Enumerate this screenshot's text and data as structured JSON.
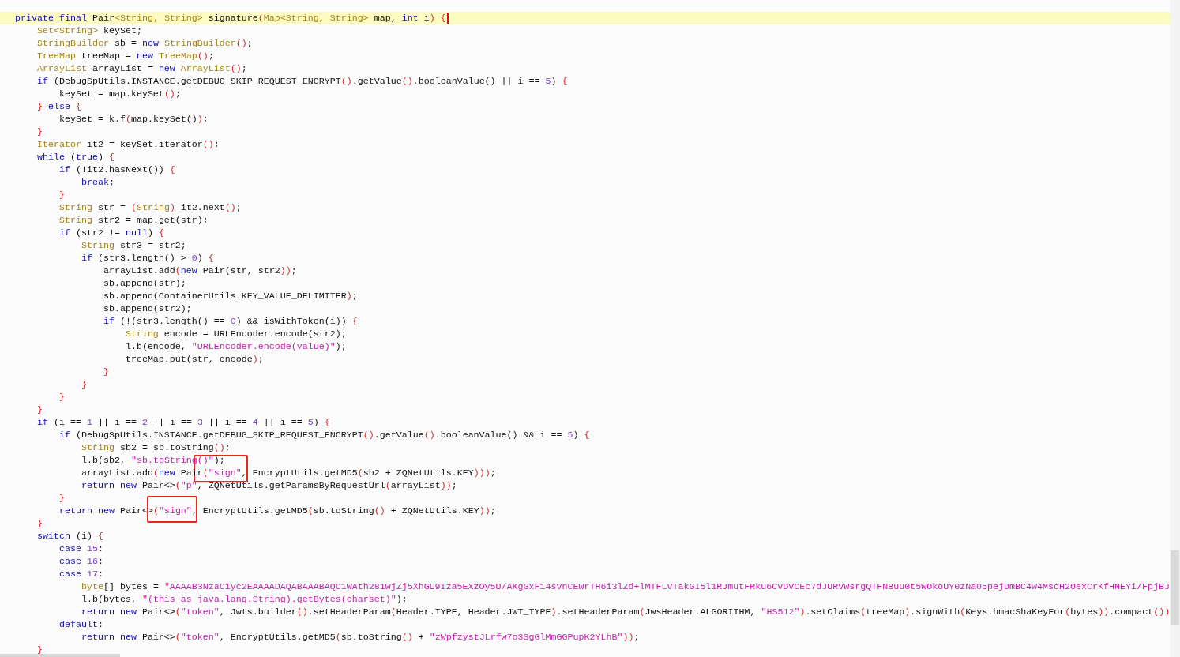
{
  "editor": {
    "lines": [
      {
        "current": true,
        "tokens": [
          {
            "kind": "keyword",
            "text": "private final"
          },
          {
            "kind": "plain",
            "text": " Pair"
          },
          {
            "kind": "type",
            "text": "<String, String>"
          },
          {
            "kind": "plain",
            "text": " signature"
          },
          {
            "kind": "bracket",
            "text": "("
          },
          {
            "kind": "type",
            "text": "Map<String, String>"
          },
          {
            "kind": "plain",
            "text": " map, "
          },
          {
            "kind": "keyword",
            "text": "int"
          },
          {
            "kind": "plain",
            "text": " i"
          },
          {
            "kind": "bracket",
            "text": ")"
          },
          {
            "kind": "bracket",
            "text": " {"
          }
        ]
      },
      {
        "current": false,
        "tokens": [
          {
            "kind": "type",
            "text": "    Set<String>"
          },
          {
            "kind": "plain",
            "text": " keySet;"
          }
        ]
      },
      {
        "current": false,
        "tokens": [
          {
            "kind": "type",
            "text": "    StringBuilder"
          },
          {
            "kind": "plain",
            "text": " sb = "
          },
          {
            "kind": "keyword",
            "text": "new"
          },
          {
            "kind": "type",
            "text": " StringBuilder"
          },
          {
            "kind": "bracket",
            "text": "()"
          },
          {
            "kind": "plain",
            "text": ";"
          }
        ]
      },
      {
        "current": false,
        "tokens": [
          {
            "kind": "type",
            "text": "    TreeMap"
          },
          {
            "kind": "plain",
            "text": " treeMap = "
          },
          {
            "kind": "keyword",
            "text": "new"
          },
          {
            "kind": "type",
            "text": " TreeMap"
          },
          {
            "kind": "bracket",
            "text": "()"
          },
          {
            "kind": "plain",
            "text": ";"
          }
        ]
      },
      {
        "current": false,
        "tokens": [
          {
            "kind": "type",
            "text": "    ArrayList"
          },
          {
            "kind": "plain",
            "text": " arrayList = "
          },
          {
            "kind": "keyword",
            "text": "new"
          },
          {
            "kind": "type",
            "text": " ArrayList"
          },
          {
            "kind": "bracket",
            "text": "()"
          },
          {
            "kind": "plain",
            "text": ";"
          }
        ]
      },
      {
        "current": false,
        "tokens": [
          {
            "kind": "keyword",
            "text": "    if"
          },
          {
            "kind": "plain",
            "text": " (DebugSpUtils.INSTANCE.getDEBUG_SKIP_REQUEST_ENCRYPT"
          },
          {
            "kind": "bracket",
            "text": "()"
          },
          {
            "kind": "plain",
            "text": ".getValue"
          },
          {
            "kind": "bracket",
            "text": "()"
          },
          {
            "kind": "plain",
            "text": ".booleanValue() || i == "
          },
          {
            "kind": "number",
            "text": "5"
          },
          {
            "kind": "plain",
            "text": ")"
          },
          {
            "kind": "bracket",
            "text": " {"
          }
        ]
      },
      {
        "current": false,
        "tokens": [
          {
            "kind": "plain",
            "text": "        keySet = map.keySet"
          },
          {
            "kind": "bracket",
            "text": "()"
          },
          {
            "kind": "plain",
            "text": ";"
          }
        ]
      },
      {
        "current": false,
        "tokens": [
          {
            "kind": "bracket",
            "text": "    }"
          },
          {
            "kind": "keyword",
            "text": " else"
          },
          {
            "kind": "bracket",
            "text": " {"
          }
        ]
      },
      {
        "current": false,
        "tokens": [
          {
            "kind": "plain",
            "text": "        keySet = k.f"
          },
          {
            "kind": "bracket",
            "text": "("
          },
          {
            "kind": "plain",
            "text": "map.keySet()"
          },
          {
            "kind": "bracket",
            "text": ")"
          },
          {
            "kind": "plain",
            "text": ";"
          }
        ]
      },
      {
        "current": false,
        "tokens": [
          {
            "kind": "bracket",
            "text": "    }"
          }
        ]
      },
      {
        "current": false,
        "tokens": [
          {
            "kind": "type",
            "text": "    Iterator"
          },
          {
            "kind": "plain",
            "text": " it2 = keySet.iterator"
          },
          {
            "kind": "bracket",
            "text": "()"
          },
          {
            "kind": "plain",
            "text": ";"
          }
        ]
      },
      {
        "current": false,
        "tokens": [
          {
            "kind": "keyword",
            "text": "    while"
          },
          {
            "kind": "plain",
            "text": " ("
          },
          {
            "kind": "keyword",
            "text": "true"
          },
          {
            "kind": "plain",
            "text": ")"
          },
          {
            "kind": "bracket",
            "text": " {"
          }
        ]
      },
      {
        "current": false,
        "tokens": [
          {
            "kind": "keyword",
            "text": "        if"
          },
          {
            "kind": "plain",
            "text": " (!it2.hasNext())"
          },
          {
            "kind": "bracket",
            "text": " {"
          }
        ]
      },
      {
        "current": false,
        "tokens": [
          {
            "kind": "keyword",
            "text": "            break"
          },
          {
            "kind": "plain",
            "text": ";"
          }
        ]
      },
      {
        "current": false,
        "tokens": [
          {
            "kind": "bracket",
            "text": "        }"
          }
        ]
      },
      {
        "current": false,
        "tokens": [
          {
            "kind": "type",
            "text": "        String"
          },
          {
            "kind": "plain",
            "text": " str = "
          },
          {
            "kind": "bracket",
            "text": "("
          },
          {
            "kind": "type",
            "text": "String"
          },
          {
            "kind": "bracket",
            "text": ")"
          },
          {
            "kind": "plain",
            "text": " it2.next"
          },
          {
            "kind": "bracket",
            "text": "()"
          },
          {
            "kind": "plain",
            "text": ";"
          }
        ]
      },
      {
        "current": false,
        "tokens": [
          {
            "kind": "type",
            "text": "        String"
          },
          {
            "kind": "plain",
            "text": " str2 = map.get(str);"
          }
        ]
      },
      {
        "current": false,
        "tokens": [
          {
            "kind": "keyword",
            "text": "        if"
          },
          {
            "kind": "plain",
            "text": " (str2 != "
          },
          {
            "kind": "keyword",
            "text": "null"
          },
          {
            "kind": "plain",
            "text": ")"
          },
          {
            "kind": "bracket",
            "text": " {"
          }
        ]
      },
      {
        "current": false,
        "tokens": [
          {
            "kind": "type",
            "text": "            String"
          },
          {
            "kind": "plain",
            "text": " str3 = str2;"
          }
        ]
      },
      {
        "current": false,
        "tokens": [
          {
            "kind": "keyword",
            "text": "            if"
          },
          {
            "kind": "plain",
            "text": " (str3.length() > "
          },
          {
            "kind": "number",
            "text": "0"
          },
          {
            "kind": "plain",
            "text": ")"
          },
          {
            "kind": "bracket",
            "text": " {"
          }
        ]
      },
      {
        "current": false,
        "tokens": [
          {
            "kind": "plain",
            "text": "                arrayList.add"
          },
          {
            "kind": "bracket",
            "text": "("
          },
          {
            "kind": "keyword",
            "text": "new"
          },
          {
            "kind": "plain",
            "text": " Pair(str, str2"
          },
          {
            "kind": "bracket",
            "text": "))"
          },
          {
            "kind": "plain",
            "text": ";"
          }
        ]
      },
      {
        "current": false,
        "tokens": [
          {
            "kind": "plain",
            "text": "                sb.append(str);"
          }
        ]
      },
      {
        "current": false,
        "tokens": [
          {
            "kind": "plain",
            "text": "                sb.append(ContainerUtils.KEY_VALUE_DELIMITER"
          },
          {
            "kind": "bracket",
            "text": ")"
          },
          {
            "kind": "plain",
            "text": ";"
          }
        ]
      },
      {
        "current": false,
        "tokens": [
          {
            "kind": "plain",
            "text": "                sb.append(str2);"
          }
        ]
      },
      {
        "current": false,
        "tokens": [
          {
            "kind": "keyword",
            "text": "                if"
          },
          {
            "kind": "plain",
            "text": " (!(str3.length() == "
          },
          {
            "kind": "number",
            "text": "0"
          },
          {
            "kind": "plain",
            "text": ") && isWithToken(i))"
          },
          {
            "kind": "bracket",
            "text": " {"
          }
        ]
      },
      {
        "current": false,
        "tokens": [
          {
            "kind": "type",
            "text": "                    String"
          },
          {
            "kind": "plain",
            "text": " encode = URLEncoder.encode(str2);"
          }
        ]
      },
      {
        "current": false,
        "tokens": [
          {
            "kind": "plain",
            "text": "                    l.b(encode, "
          },
          {
            "kind": "string",
            "text": "\"URLEncoder.encode(value)\""
          },
          {
            "kind": "plain",
            "text": ");"
          }
        ]
      },
      {
        "current": false,
        "tokens": [
          {
            "kind": "plain",
            "text": "                    treeMap.put(str, encode"
          },
          {
            "kind": "bracket",
            "text": ")"
          },
          {
            "kind": "plain",
            "text": ";"
          }
        ]
      },
      {
        "current": false,
        "tokens": [
          {
            "kind": "bracket",
            "text": "                }"
          }
        ]
      },
      {
        "current": false,
        "tokens": [
          {
            "kind": "bracket",
            "text": "            }"
          }
        ]
      },
      {
        "current": false,
        "tokens": [
          {
            "kind": "bracket",
            "text": "        }"
          }
        ]
      },
      {
        "current": false,
        "tokens": [
          {
            "kind": "bracket",
            "text": "    }"
          }
        ]
      },
      {
        "current": false,
        "tokens": [
          {
            "kind": "keyword",
            "text": "    if"
          },
          {
            "kind": "plain",
            "text": " (i == "
          },
          {
            "kind": "number",
            "text": "1"
          },
          {
            "kind": "plain",
            "text": " || i == "
          },
          {
            "kind": "number",
            "text": "2"
          },
          {
            "kind": "plain",
            "text": " || i == "
          },
          {
            "kind": "number",
            "text": "3"
          },
          {
            "kind": "plain",
            "text": " || i == "
          },
          {
            "kind": "number",
            "text": "4"
          },
          {
            "kind": "plain",
            "text": " || i == "
          },
          {
            "kind": "number",
            "text": "5"
          },
          {
            "kind": "plain",
            "text": ")"
          },
          {
            "kind": "bracket",
            "text": " {"
          }
        ]
      },
      {
        "current": false,
        "tokens": [
          {
            "kind": "keyword",
            "text": "        if"
          },
          {
            "kind": "plain",
            "text": " (DebugSpUtils.INSTANCE.getDEBUG_SKIP_REQUEST_ENCRYPT"
          },
          {
            "kind": "bracket",
            "text": "()"
          },
          {
            "kind": "plain",
            "text": ".getValue"
          },
          {
            "kind": "bracket",
            "text": "()"
          },
          {
            "kind": "plain",
            "text": ".booleanValue() && i == "
          },
          {
            "kind": "number",
            "text": "5"
          },
          {
            "kind": "plain",
            "text": ")"
          },
          {
            "kind": "bracket",
            "text": " {"
          }
        ]
      },
      {
        "current": false,
        "tokens": [
          {
            "kind": "type",
            "text": "            String"
          },
          {
            "kind": "plain",
            "text": " sb2 = sb.toString"
          },
          {
            "kind": "bracket",
            "text": "()"
          },
          {
            "kind": "plain",
            "text": ";"
          }
        ]
      },
      {
        "current": false,
        "tokens": [
          {
            "kind": "plain",
            "text": "            l.b(sb2, "
          },
          {
            "kind": "string",
            "text": "\"sb.toString()\""
          },
          {
            "kind": "plain",
            "text": ");"
          }
        ]
      },
      {
        "current": false,
        "tokens": [
          {
            "kind": "plain",
            "text": "            arrayList.add"
          },
          {
            "kind": "bracket",
            "text": "("
          },
          {
            "kind": "keyword",
            "text": "new"
          },
          {
            "kind": "plain",
            "text": " Pair"
          },
          {
            "kind": "bracket",
            "text": "("
          },
          {
            "kind": "string",
            "text": "\"sign\""
          },
          {
            "kind": "plain",
            "text": ", EncryptUtils.getMD5"
          },
          {
            "kind": "bracket",
            "text": "("
          },
          {
            "kind": "plain",
            "text": "sb2 + ZQNetUtils.KEY"
          },
          {
            "kind": "bracket",
            "text": ")))"
          },
          {
            "kind": "plain",
            "text": ";"
          }
        ]
      },
      {
        "current": false,
        "tokens": [
          {
            "kind": "keyword",
            "text": "            return new"
          },
          {
            "kind": "plain",
            "text": " Pair<>"
          },
          {
            "kind": "bracket",
            "text": "("
          },
          {
            "kind": "string",
            "text": "\"p\""
          },
          {
            "kind": "plain",
            "text": ", ZQNetUtils.getParamsByRequestUrl"
          },
          {
            "kind": "bracket",
            "text": "("
          },
          {
            "kind": "plain",
            "text": "arrayList"
          },
          {
            "kind": "bracket",
            "text": "))"
          },
          {
            "kind": "plain",
            "text": ";"
          }
        ]
      },
      {
        "current": false,
        "tokens": [
          {
            "kind": "bracket",
            "text": "        }"
          }
        ]
      },
      {
        "current": false,
        "tokens": [
          {
            "kind": "keyword",
            "text": "        return new"
          },
          {
            "kind": "plain",
            "text": " Pair<>"
          },
          {
            "kind": "bracket",
            "text": "("
          },
          {
            "kind": "string",
            "text": "\"sign\""
          },
          {
            "kind": "plain",
            "text": ", EncryptUtils.getMD5"
          },
          {
            "kind": "bracket",
            "text": "("
          },
          {
            "kind": "plain",
            "text": "sb.toString"
          },
          {
            "kind": "bracket",
            "text": "()"
          },
          {
            "kind": "plain",
            "text": " + ZQNetUtils.KEY"
          },
          {
            "kind": "bracket",
            "text": "))"
          },
          {
            "kind": "plain",
            "text": ";"
          }
        ]
      },
      {
        "current": false,
        "tokens": [
          {
            "kind": "bracket",
            "text": "    }"
          }
        ]
      },
      {
        "current": false,
        "tokens": [
          {
            "kind": "keyword",
            "text": "    switch"
          },
          {
            "kind": "plain",
            "text": " (i)"
          },
          {
            "kind": "bracket",
            "text": " {"
          }
        ]
      },
      {
        "current": false,
        "tokens": [
          {
            "kind": "keyword",
            "text": "        case"
          },
          {
            "kind": "number",
            "text": " 15"
          },
          {
            "kind": "plain",
            "text": ":"
          }
        ]
      },
      {
        "current": false,
        "tokens": [
          {
            "kind": "keyword",
            "text": "        case"
          },
          {
            "kind": "number",
            "text": " 16"
          },
          {
            "kind": "plain",
            "text": ":"
          }
        ]
      },
      {
        "current": false,
        "tokens": [
          {
            "kind": "keyword",
            "text": "        case"
          },
          {
            "kind": "number",
            "text": " 17"
          },
          {
            "kind": "plain",
            "text": ":"
          }
        ]
      },
      {
        "current": false,
        "tokens": [
          {
            "kind": "type",
            "text": "            byte"
          },
          {
            "kind": "plain",
            "text": "[] bytes = "
          },
          {
            "kind": "string",
            "text": "\"AAAAB3NzaC1yc2EAAAADAQABAAABAQC1WAth281wjZj5XhGU9Iza5EXzOy5U/AKgGxF14svnCEWrTH6i3lZd+lMTFLvTakGI5l1RJmutFRku6CvDVCEc7dJURVWsrgQTFNBuu0t5WOkoUY0zNa05pejDmBC4w4MscH2OexCrKfHNEYi/FpjBJ"
          }
        ]
      },
      {
        "current": false,
        "tokens": [
          {
            "kind": "plain",
            "text": "            l.b(bytes, "
          },
          {
            "kind": "string",
            "text": "\"(this as java.lang.String).getBytes(charset)\""
          },
          {
            "kind": "plain",
            "text": ");"
          }
        ]
      },
      {
        "current": false,
        "tokens": [
          {
            "kind": "keyword",
            "text": "            return new"
          },
          {
            "kind": "plain",
            "text": " Pair<>"
          },
          {
            "kind": "bracket",
            "text": "("
          },
          {
            "kind": "string",
            "text": "\"token\""
          },
          {
            "kind": "plain",
            "text": ", Jwts.builder"
          },
          {
            "kind": "bracket",
            "text": "()"
          },
          {
            "kind": "plain",
            "text": ".setHeaderParam"
          },
          {
            "kind": "bracket",
            "text": "("
          },
          {
            "kind": "plain",
            "text": "Header.TYPE, Header.JWT_TYPE"
          },
          {
            "kind": "bracket",
            "text": ")"
          },
          {
            "kind": "plain",
            "text": ".setHeaderParam"
          },
          {
            "kind": "bracket",
            "text": "("
          },
          {
            "kind": "plain",
            "text": "JwsHeader.ALGORITHM, "
          },
          {
            "kind": "string",
            "text": "\"HS512\""
          },
          {
            "kind": "bracket",
            "text": ")"
          },
          {
            "kind": "plain",
            "text": ".setClaims"
          },
          {
            "kind": "bracket",
            "text": "("
          },
          {
            "kind": "plain",
            "text": "treeMap"
          },
          {
            "kind": "bracket",
            "text": ")"
          },
          {
            "kind": "plain",
            "text": ".signWith"
          },
          {
            "kind": "bracket",
            "text": "("
          },
          {
            "kind": "plain",
            "text": "Keys.hmacShaKeyFor"
          },
          {
            "kind": "bracket",
            "text": "("
          },
          {
            "kind": "plain",
            "text": "bytes"
          },
          {
            "kind": "bracket",
            "text": "))"
          },
          {
            "kind": "plain",
            "text": ".compact"
          },
          {
            "kind": "bracket",
            "text": "())"
          }
        ]
      },
      {
        "current": false,
        "tokens": [
          {
            "kind": "keyword",
            "text": "        default"
          },
          {
            "kind": "plain",
            "text": ":"
          }
        ]
      },
      {
        "current": false,
        "tokens": [
          {
            "kind": "keyword",
            "text": "            return new"
          },
          {
            "kind": "plain",
            "text": " Pair<>"
          },
          {
            "kind": "bracket",
            "text": "("
          },
          {
            "kind": "string",
            "text": "\"token\""
          },
          {
            "kind": "plain",
            "text": ", EncryptUtils.getMD5"
          },
          {
            "kind": "bracket",
            "text": "("
          },
          {
            "kind": "plain",
            "text": "sb.toString"
          },
          {
            "kind": "bracket",
            "text": "()"
          },
          {
            "kind": "plain",
            "text": " + "
          },
          {
            "kind": "string",
            "text": "\"zWpfzystJLrfw7o3SgGlMmGGPupK2YLhB\""
          },
          {
            "kind": "bracket",
            "text": "))"
          },
          {
            "kind": "plain",
            "text": ";"
          }
        ]
      },
      {
        "current": false,
        "tokens": [
          {
            "kind": "bracket",
            "text": "    }"
          }
        ]
      }
    ]
  }
}
